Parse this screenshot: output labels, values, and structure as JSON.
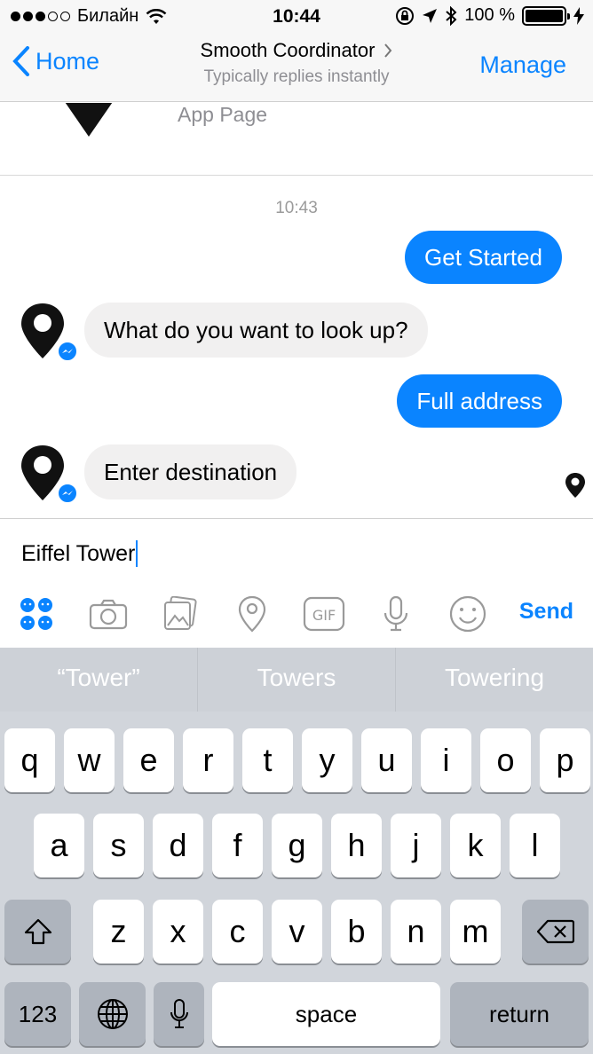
{
  "status_bar": {
    "carrier": "Билайн",
    "time": "10:44",
    "battery": "100 %"
  },
  "nav": {
    "back_label": "Home",
    "title": "Smooth Coordinator",
    "subtitle": "Typically replies instantly",
    "manage_label": "Manage"
  },
  "chat": {
    "page_label": "App Page",
    "timestamp": "10:43",
    "messages": [
      {
        "from": "user",
        "text": "Get Started"
      },
      {
        "from": "bot",
        "text": "What do you want to look up?"
      },
      {
        "from": "user",
        "text": "Full address"
      },
      {
        "from": "bot",
        "text": "Enter destination"
      }
    ]
  },
  "composer": {
    "input_value": "Eiffel Tower",
    "send_label": "Send",
    "tools": [
      "apps-icon",
      "camera-icon",
      "gallery-icon",
      "location-icon",
      "gif-icon",
      "microphone-icon",
      "emoji-icon"
    ]
  },
  "keyboard": {
    "suggestions": [
      "“Tower”",
      "Towers",
      "Towering"
    ],
    "row1": [
      "q",
      "w",
      "e",
      "r",
      "t",
      "y",
      "u",
      "i",
      "o",
      "p"
    ],
    "row2": [
      "a",
      "s",
      "d",
      "f",
      "g",
      "h",
      "j",
      "k",
      "l"
    ],
    "row3": [
      "z",
      "x",
      "c",
      "v",
      "b",
      "n",
      "m"
    ],
    "numbers_label": "123",
    "space_label": "space",
    "return_label": "return"
  },
  "colors": {
    "accent": "#0a84ff",
    "bubble_in": "#f1f0f0",
    "keyboard_bg": "#d1d5db"
  }
}
